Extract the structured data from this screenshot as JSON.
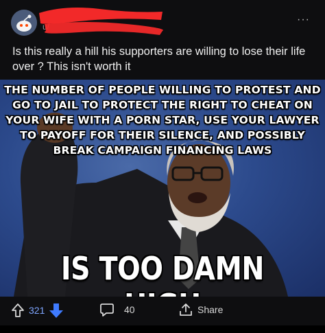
{
  "post": {
    "username": "u/",
    "title": "Is this really a hill his supporters are willing to lose their life over ? This isn't worth it",
    "more_label": "···"
  },
  "meme": {
    "top_text": "The number of people willing to protest and go to jail to protect the right to cheat on your wife with a porn star, use your lawyer to payoff for their silence, and possibly break campaign financing laws",
    "bottom_text": "IS TOO DAMN HIGH",
    "background_color": "#2c4a8c"
  },
  "actions": {
    "score": "321",
    "comments": "40",
    "share_label": "Share",
    "icons": [
      "upvote-icon",
      "downvote-icon",
      "comment-icon",
      "share-icon"
    ],
    "accent_color": "#7fa6ff"
  }
}
